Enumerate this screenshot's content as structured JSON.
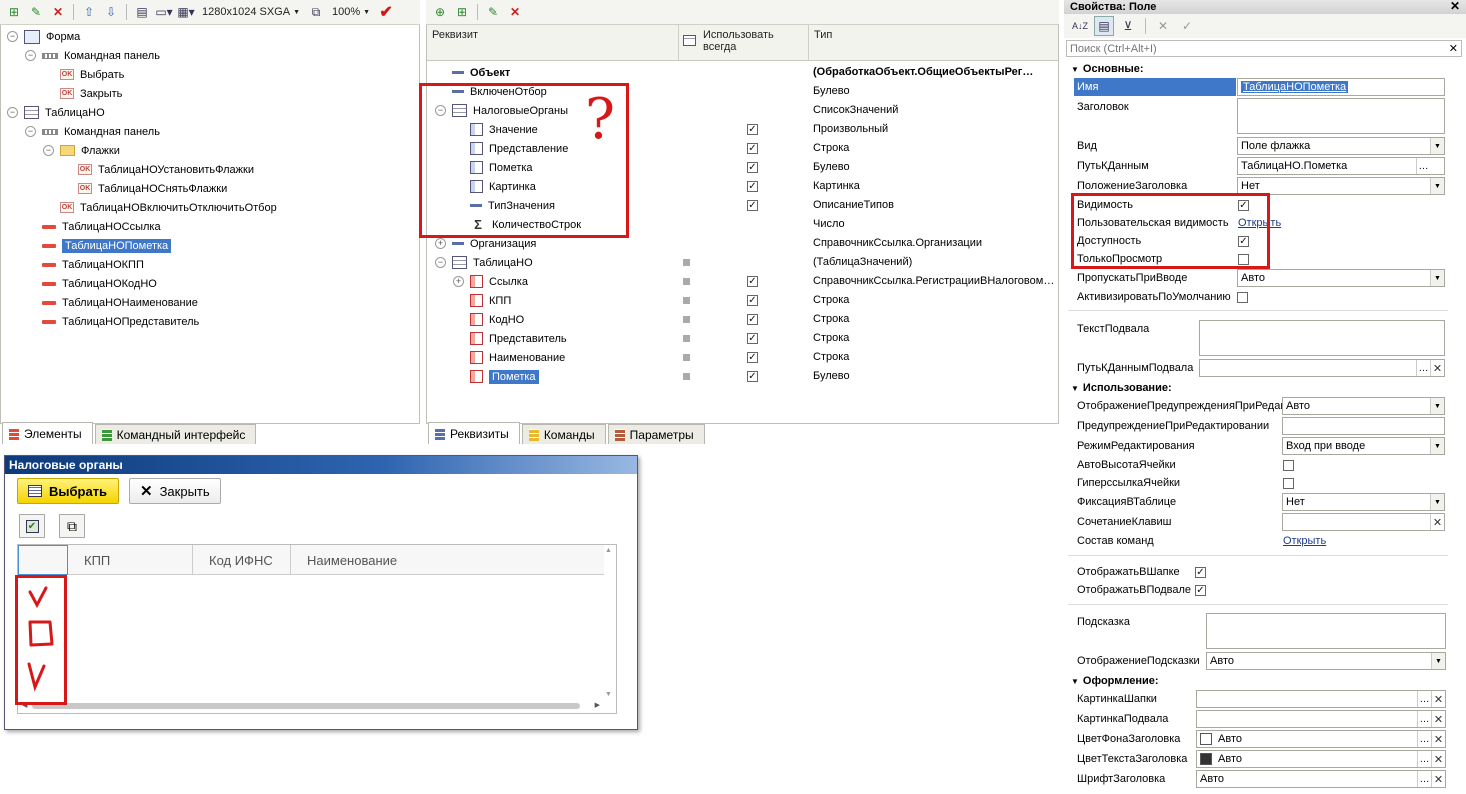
{
  "toolbar_left": {
    "resolution": "1280x1024 SXGA",
    "zoom": "100%"
  },
  "form_tree": {
    "items": [
      {
        "label": "Форма",
        "level": 0,
        "icon": "form-icon"
      },
      {
        "label": "Командная панель",
        "level": 1,
        "icon": "command-panel-icon"
      },
      {
        "label": "Выбрать",
        "level": 2,
        "icon": "command-button-icon"
      },
      {
        "label": "Закрыть",
        "level": 2,
        "icon": "command-button-icon"
      },
      {
        "label": "ТаблицаНО",
        "level": 0,
        "icon": "table-icon"
      },
      {
        "label": "Командная панель",
        "level": 1,
        "icon": "command-panel-icon"
      },
      {
        "label": "Флажки",
        "level": 2,
        "icon": "folder-icon"
      },
      {
        "label": "ТаблицаНОУстановитьФлажки",
        "level": 3,
        "icon": "command-button-icon"
      },
      {
        "label": "ТаблицаНОСнятьФлажки",
        "level": 3,
        "icon": "command-button-icon"
      },
      {
        "label": "ТаблицаНОВключитьОтключитьОтбор",
        "level": 2,
        "icon": "command-button-icon"
      },
      {
        "label": "ТаблицаНОСсылка",
        "level": 1,
        "icon": "field-icon"
      },
      {
        "label": "ТаблицаНОПометка",
        "level": 1,
        "icon": "field-icon"
      },
      {
        "label": "ТаблицаНОКПП",
        "level": 1,
        "icon": "field-icon"
      },
      {
        "label": "ТаблицаНОКодНО",
        "level": 1,
        "icon": "field-icon"
      },
      {
        "label": "ТаблицаНОНаименование",
        "level": 1,
        "icon": "field-icon"
      },
      {
        "label": "ТаблицаНОПредставитель",
        "level": 1,
        "icon": "field-icon"
      }
    ],
    "tabs": [
      "Элементы",
      "Командный интерфейс"
    ]
  },
  "attributes": {
    "headers": {
      "name": "Реквизит",
      "always": "Использовать всегда",
      "type": "Тип"
    },
    "rows": [
      {
        "name": "Объект",
        "type": "(ОбработкаОбъект.ОбщиеОбъектыРег…"
      },
      {
        "name": "ВключенОтбор",
        "type": "Булево"
      },
      {
        "name": "НалоговыеОрганы",
        "type": "СписокЗначений"
      },
      {
        "name": "Значение",
        "type": "Произвольный"
      },
      {
        "name": "Представление",
        "type": "Строка"
      },
      {
        "name": "Пометка",
        "type": "Булево"
      },
      {
        "name": "Картинка",
        "type": "Картинка"
      },
      {
        "name": "ТипЗначения",
        "type": "ОписаниеТипов"
      },
      {
        "name": "КоличествоСтрок",
        "type": "Число"
      },
      {
        "name": "Организация",
        "type": "СправочникСсылка.Организации"
      },
      {
        "name": "ТаблицаНО",
        "type": "(ТаблицаЗначений)"
      },
      {
        "name": "Ссылка",
        "type": "СправочникСсылка.РегистрацииВНалоговом…"
      },
      {
        "name": "КПП",
        "type": "Строка"
      },
      {
        "name": "КодНО",
        "type": "Строка"
      },
      {
        "name": "Представитель",
        "type": "Строка"
      },
      {
        "name": "Наименование",
        "type": "Строка"
      },
      {
        "name": "Пометка",
        "type": "Булево"
      }
    ],
    "tabs": [
      "Реквизиты",
      "Команды",
      "Параметры"
    ],
    "annotation": "?"
  },
  "preview": {
    "title": "Налоговые органы",
    "select_label": "Выбрать",
    "close_label": "Закрыть",
    "columns": [
      "КПП",
      "Код ИФНС",
      "Наименование"
    ]
  },
  "properties": {
    "title": "Свойства: Поле",
    "search_placeholder": "Поиск (Ctrl+Alt+I)",
    "sections": {
      "main": "Основные:",
      "usage": "Использование:",
      "design": "Оформление:"
    },
    "labels": {
      "name": "Имя",
      "header": "Заголовок",
      "kind": "Вид",
      "data_path": "ПутьКДанным",
      "title_position": "ПоложениеЗаголовка",
      "visibility": "Видимость",
      "user_visibility": "Пользовательская видимость",
      "availability": "Доступность",
      "read_only": "ТолькоПросмотр",
      "skip_on_input": "ПропускатьПриВводе",
      "activate_default": "АктивизироватьПоУмолчанию",
      "footer_text": "ТекстПодвала",
      "footer_data_path": "ПутьКДаннымПодвала",
      "edit_warning_display": "ОтображениеПредупрежденияПриРедак",
      "edit_warning": "ПредупреждениеПриРедактировании",
      "edit_mode": "РежимРедактирования",
      "auto_cell_height": "АвтоВысотаЯчейки",
      "cell_hyperlink": "ГиперссылкаЯчейки",
      "fix_in_table": "ФиксацияВТаблице",
      "shortcut": "СочетаниеКлавиш",
      "commands": "Состав команд",
      "show_in_header": "ОтображатьВШапке",
      "show_in_footer": "ОтображатьВПодвале",
      "tooltip": "Подсказка",
      "tooltip_display": "ОтображениеПодсказки",
      "header_picture": "КартинкаШапки",
      "footer_picture": "КартинкаПодвала",
      "header_bg_color": "ЦветФонаЗаголовка",
      "header_text_color": "ЦветТекстаЗаголовка",
      "header_font": "ШрифтЗаголовка"
    },
    "values": {
      "name": "ТаблицаНОПометка",
      "kind": "Поле флажка",
      "data_path": "ТаблицаНО.Пометка",
      "title_position": "Нет",
      "user_visibility": "Открыть",
      "skip_on_input": "Авто",
      "edit_warning_display": "Авто",
      "edit_mode": "Вход при вводе",
      "fix_in_table": "Нет",
      "commands": "Открыть",
      "tooltip_display": "Авто",
      "header_bg_color": "Авто",
      "header_text_color": "Авто",
      "header_font": "Авто"
    },
    "colors": {
      "header_bg": "#ffffff",
      "header_text": "#333333"
    }
  }
}
